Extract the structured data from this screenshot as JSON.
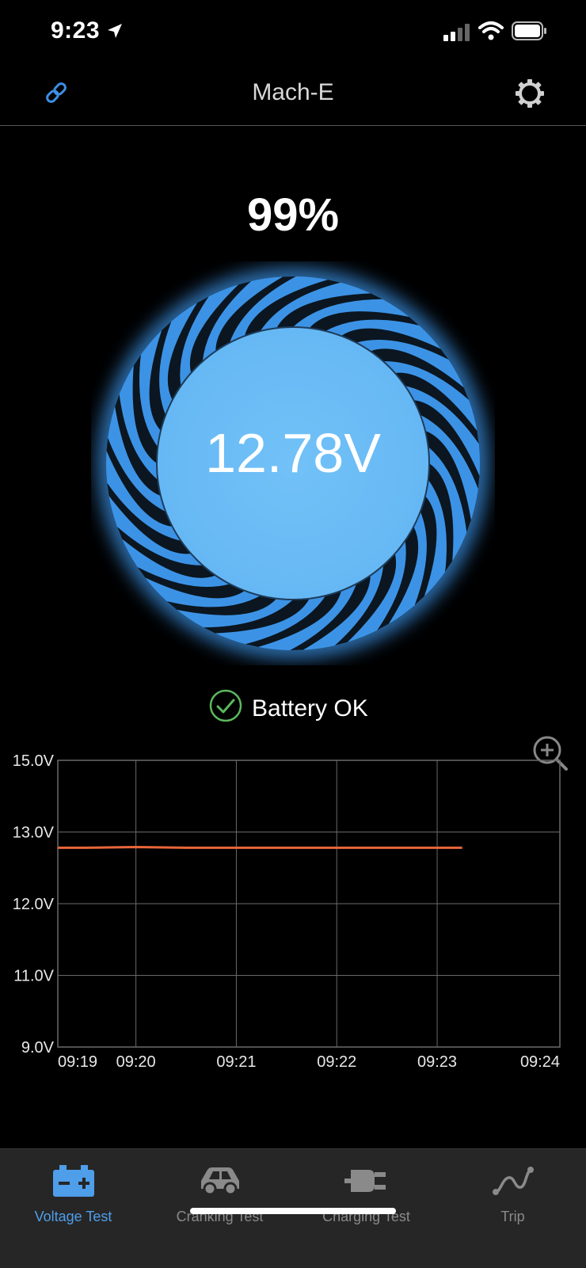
{
  "status_bar": {
    "time": "9:23"
  },
  "nav": {
    "title": "Mach-E",
    "left_icon": "link-icon",
    "right_icon": "gear-icon"
  },
  "gauge": {
    "percent_label": "99%",
    "percent_value": 99,
    "voltage_label": "12.78V",
    "accent_color": "#6dbdf6"
  },
  "status": {
    "text": "Battery OK",
    "icon": "check-circle-icon",
    "color": "#5cb85c"
  },
  "chart_data": {
    "type": "line",
    "title": "",
    "xlabel": "",
    "ylabel": "",
    "y_tick_labels": [
      "15.0V",
      "13.0V",
      "12.0V",
      "11.0V",
      "9.0V"
    ],
    "x_tick_labels": [
      "09:19",
      "09:20",
      "09:21",
      "09:22",
      "09:23",
      "09:24"
    ],
    "grid": true,
    "series": [
      {
        "color": "#e8663a",
        "x": [
          "09:19",
          "09:19:30",
          "09:20",
          "09:20:30",
          "09:21",
          "09:21:30",
          "09:22",
          "09:22:30",
          "09:23",
          "09:23:15"
        ],
        "values": [
          12.78,
          12.78,
          12.79,
          12.78,
          12.78,
          12.78,
          12.78,
          12.78,
          12.78,
          12.78
        ]
      }
    ]
  },
  "tabs": [
    {
      "label": "Voltage Test",
      "icon": "battery-icon",
      "active": true
    },
    {
      "label": "Cranking Test",
      "icon": "car-icon",
      "active": false
    },
    {
      "label": "Charging Test",
      "icon": "plug-icon",
      "active": false
    },
    {
      "label": "Trip",
      "icon": "trip-route-icon",
      "active": false
    }
  ]
}
